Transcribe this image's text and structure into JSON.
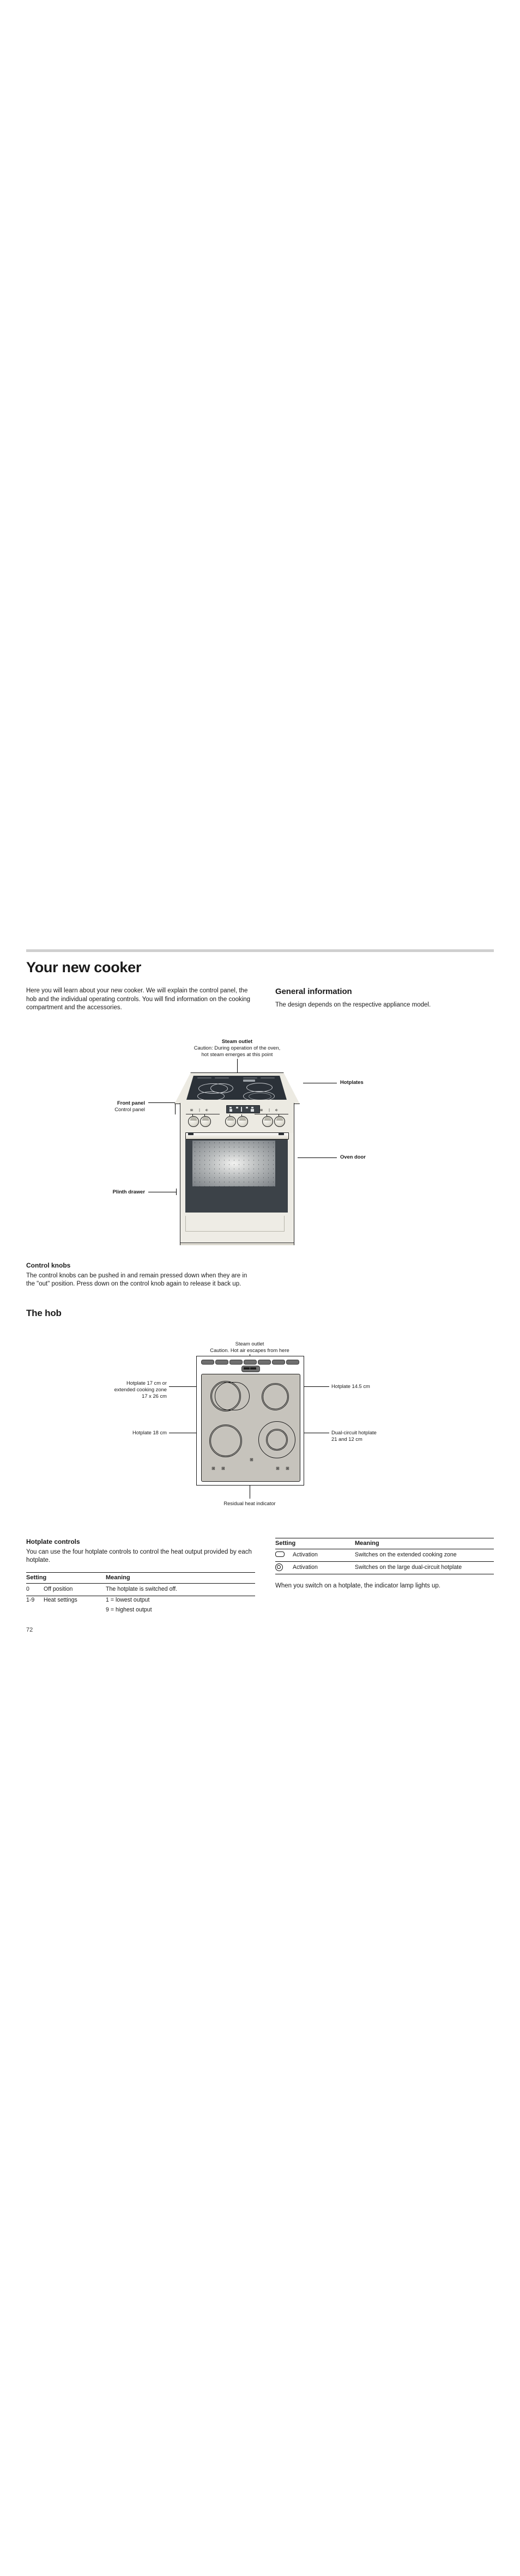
{
  "page": {
    "number": "72"
  },
  "header": {
    "title": "Your new cooker"
  },
  "intro": {
    "paragraph": "Here you will learn about your new cooker. We will explain the control panel, the hob and the individual operating controls. You will find information on the cooking compartment and the accessories."
  },
  "general_information": {
    "heading": "General information",
    "paragraph": "The design depends on the respective appliance model."
  },
  "cooker_figure": {
    "steam_outlet_title": "Steam outlet",
    "steam_outlet_caution_line1": "Caution: During operation of the oven,",
    "steam_outlet_caution_line2": "hot steam emerges at this point",
    "hotplates_label": "Hotplates",
    "front_panel_label": "Front panel",
    "control_panel_label": "Control panel",
    "oven_door_label": "Oven door",
    "plinth_drawer_label": "Plinth drawer"
  },
  "control_knobs": {
    "heading": "Control knobs",
    "paragraph": "The control knobs can be pushed in and remain pressed down when they are in the \"out\" position. Press down on the control knob again to release it back up."
  },
  "the_hob": {
    "heading": "The hob",
    "steam_outlet_title": "Steam outlet",
    "steam_outlet_caution": "Caution. Hot air escapes from here",
    "label_left_top_line1": "Hotplate 17 cm or",
    "label_left_top_line2": "extended cooking zone",
    "label_left_top_line3": "17 x 26 cm",
    "label_right_top": "Hotplate 14.5 cm",
    "label_left_bottom": "Hotplate 18 cm",
    "label_right_bottom_line1": "Dual-circuit hotplate",
    "label_right_bottom_line2": "21 and 12 cm",
    "label_residual": "Residual heat indicator"
  },
  "hotplate_controls": {
    "heading": "Hotplate controls",
    "paragraph": "You can use the four hotplate controls to control the heat output provided by each hotplate.",
    "table_left": {
      "col_setting": "Setting",
      "col_meaning": "Meaning",
      "rows": [
        {
          "setting": "0",
          "name": "Off position",
          "meaning": "The hotplate is switched off.",
          "meaning2": ""
        },
        {
          "setting": "1-9",
          "name": "Heat settings",
          "meaning": "1 = lowest output",
          "meaning2": "9 = highest output"
        }
      ]
    },
    "table_right": {
      "col_setting": "Setting",
      "col_meaning": "Meaning",
      "rows": [
        {
          "icon": "extended-cooking-zone-icon",
          "name": "Activation",
          "meaning": "Switches on the extended cooking zone"
        },
        {
          "icon": "dual-circuit-icon",
          "name": "Activation",
          "meaning": "Switches on the large dual-circuit hotplate"
        }
      ]
    },
    "footnote": "When you switch on a hotplate, the indicator lamp lights up."
  }
}
